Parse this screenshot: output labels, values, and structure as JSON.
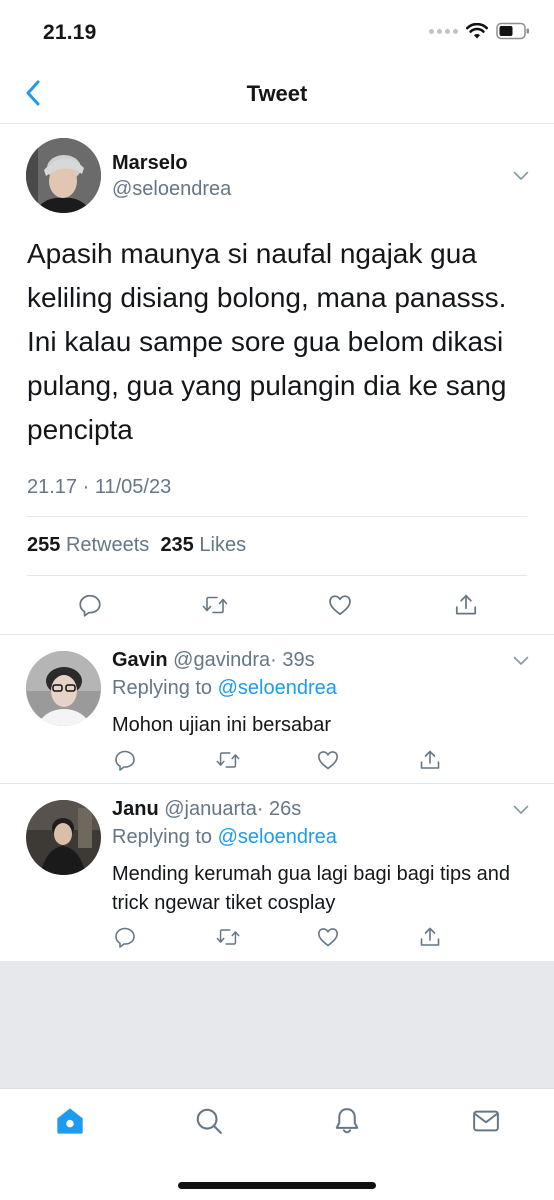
{
  "status_bar": {
    "time": "21.19"
  },
  "header": {
    "title": "Tweet"
  },
  "main_tweet": {
    "name": "Marselo",
    "handle": "@seloendrea",
    "text": "Apasih maunya si naufal ngajak gua keliling disiang bolong, mana panasss. Ini kalau sampe sore gua belom dikasi pulang, gua yang pulangin dia ke sang pencipta",
    "timestamp": "21.17 · 11/05/23",
    "retweets_count": "255",
    "retweets_label": "Retweets",
    "likes_count": "235",
    "likes_label": "Likes"
  },
  "replies": [
    {
      "name": "Gavin",
      "handle": "@gavindra",
      "time": "· 39s",
      "replying_label": "Replying to",
      "replying_to": "@seloendrea",
      "text": "Mohon ujian ini bersabar"
    },
    {
      "name": "Janu",
      "handle": "@januarta",
      "time": "· 26s",
      "replying_label": "Replying to",
      "replying_to": "@seloendrea",
      "text": "Mending kerumah gua lagi bagi bagi tips and trick ngewar tiket cosplay"
    }
  ],
  "tab_bar": {
    "tabs": [
      "home-icon",
      "search-icon",
      "notifications-icon",
      "messages-icon"
    ]
  },
  "colors": {
    "accent": "#1d9bf0",
    "secondary_text": "#657786",
    "divider": "#e1e8ed",
    "filler": "#e6e8eb"
  }
}
